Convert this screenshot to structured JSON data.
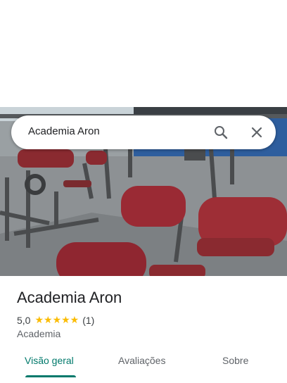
{
  "search": {
    "query": "Academia Aron"
  },
  "icons": {
    "search": "search-icon",
    "close": "close-icon"
  },
  "place": {
    "title": "Academia Aron",
    "rating": "5,0",
    "stars": "★★★★★",
    "review_count": "(1)",
    "category": "Academia"
  },
  "tabs": [
    {
      "label": "Visão geral",
      "active": true
    },
    {
      "label": "Avaliações",
      "active": false
    },
    {
      "label": "Sobre",
      "active": false
    }
  ],
  "colors": {
    "accent": "#00796b",
    "star": "#fbbc04"
  }
}
